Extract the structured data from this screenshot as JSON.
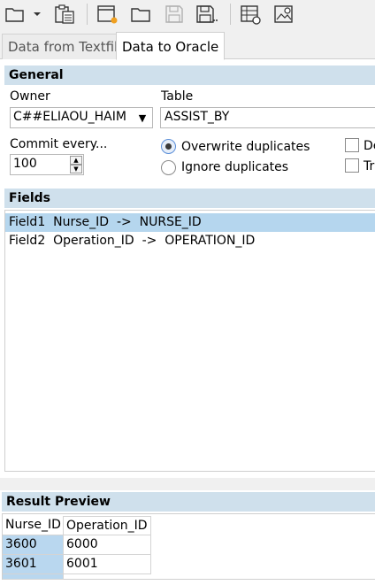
{
  "toolbar": {
    "icons": [
      "open-folder-icon",
      "dropdown-arrow-icon",
      "clipboard-icon",
      "new-window-icon",
      "folder-icon",
      "save-icon",
      "save-as-icon",
      "table-settings-icon",
      "image-settings-icon"
    ]
  },
  "tabs": [
    {
      "label": "Data from Textfile",
      "active": false
    },
    {
      "label": "Data to Oracle",
      "active": true
    }
  ],
  "general": {
    "heading": "General",
    "owner_label": "Owner",
    "owner_value": "C##ELIAOU_HAIM",
    "table_label": "Table",
    "table_value": "ASSIST_BY",
    "commit_label": "Commit every...",
    "commit_value": "100",
    "overwrite_label": "Overwrite duplicates",
    "ignore_label": "Ignore duplicates",
    "overwrite_selected": true,
    "check1_label": "De",
    "check2_label": "Tr"
  },
  "fields": {
    "heading": "Fields",
    "rows": [
      {
        "text": "Field1  Nurse_ID  ->  NURSE_ID",
        "selected": true
      },
      {
        "text": "Field2  Operation_ID  ->  OPERATION_ID",
        "selected": false
      }
    ]
  },
  "preview": {
    "heading": "Result Preview",
    "columns": [
      "Nurse_ID",
      "Operation_ID"
    ],
    "rows": [
      [
        "3600",
        "6000"
      ],
      [
        "3601",
        "6001"
      ]
    ]
  },
  "colors": {
    "section_header": "#cfe0ec",
    "selection": "#b5d6ee"
  }
}
